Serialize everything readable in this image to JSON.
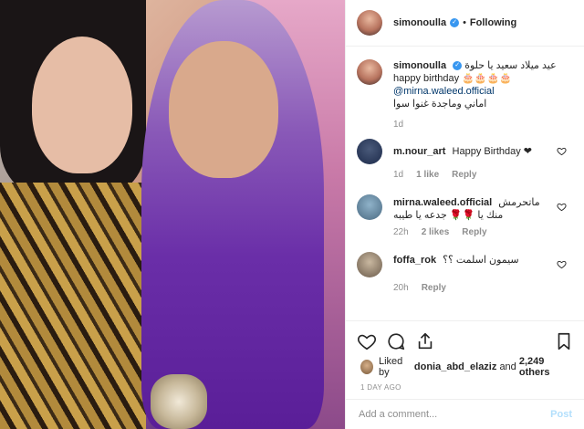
{
  "post": {
    "username": "simonoulla",
    "following_label": "Following",
    "separator": "•"
  },
  "caption": {
    "username": "simonoulla",
    "text_line1": "عيد ميلاد سعيد يا حلوة happy birthday 🎂🎂🎂🎂",
    "mention": "@mirna.waleed.official",
    "text_line3": "اماني وماجدة غنوا سوا",
    "time": "1d"
  },
  "comments": [
    {
      "username": "m.nour_art",
      "text": "Happy Birthday ❤",
      "time": "1d",
      "likes": "1 like",
      "reply": "Reply"
    },
    {
      "username": "mirna.waleed.official",
      "text": "ماتحرمش منك يا 🌹🌹 جدعه يا طيبه",
      "time": "22h",
      "likes": "2 likes",
      "reply": "Reply"
    },
    {
      "username": "foffa_rok",
      "text": "سيمون اسلمت ؟؟",
      "time": "20h",
      "reply": "Reply"
    }
  ],
  "likes_summary": {
    "prefix": "Liked by",
    "user": "donia_abd_elaziz",
    "middle": "and",
    "count": "2,249 others"
  },
  "timestamp": "1 DAY AGO",
  "add_comment": {
    "placeholder": "Add a comment...",
    "post_label": "Post"
  },
  "colors": {
    "link": "#00376b",
    "verified": "#3897f0",
    "muted": "#8e8e8e",
    "post_disabled": "#b2dffc"
  }
}
